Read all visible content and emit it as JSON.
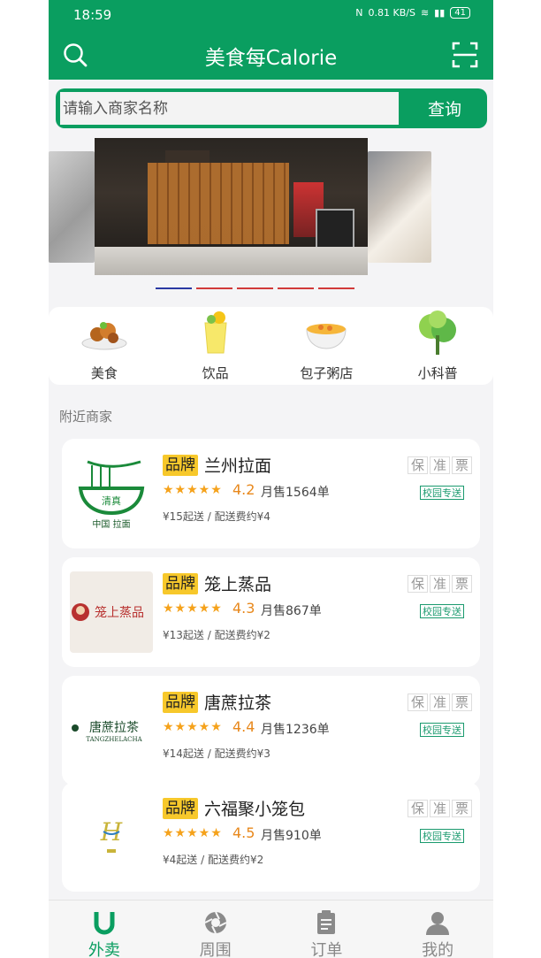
{
  "status": {
    "time": "18:59",
    "net_speed": "0.81 KB/S",
    "battery": "41"
  },
  "header": {
    "title": "美食每Calorie"
  },
  "search": {
    "placeholder": "请输入商家名称",
    "button_label": "查询"
  },
  "categories": [
    {
      "label": "美食",
      "icon": "food-dish-icon"
    },
    {
      "label": "饮品",
      "icon": "drink-cup-icon"
    },
    {
      "label": "包子粥店",
      "icon": "congee-bowl-icon"
    },
    {
      "label": "小科普",
      "icon": "tree-icon"
    }
  ],
  "section": {
    "title": "附近商家"
  },
  "shops": [
    {
      "brand_tag": "品牌",
      "name": "兰州拉面",
      "rating": "4.2",
      "sales": "月售1564单",
      "min_order": "¥15起送",
      "fee": "配送费约¥4",
      "guarantees": [
        "保",
        "准",
        "票"
      ],
      "campus": "校园专送",
      "logo_text": "清真 中国 拉面"
    },
    {
      "brand_tag": "品牌",
      "name": "笼上蒸品",
      "rating": "4.3",
      "sales": "月售867单",
      "min_order": "¥13起送",
      "fee": "配送费约¥2",
      "guarantees": [
        "保",
        "准",
        "票"
      ],
      "campus": "校园专送",
      "logo_text": "笼上蒸品"
    },
    {
      "brand_tag": "品牌",
      "name": "唐蔗拉茶",
      "rating": "4.4",
      "sales": "月售1236单",
      "min_order": "¥14起送",
      "fee": "配送费约¥3",
      "guarantees": [
        "保",
        "准",
        "票"
      ],
      "campus": "校园专送",
      "logo_text": "唐蔗拉茶"
    },
    {
      "brand_tag": "品牌",
      "name": "六福聚小笼包",
      "rating": "4.5",
      "sales": "月售910单",
      "min_order": "¥4起送",
      "fee": "配送费约¥2",
      "guarantees": [
        "保",
        "准",
        "票"
      ],
      "campus": "校园专送",
      "logo_text": "H"
    }
  ],
  "nav": [
    {
      "label": "外卖",
      "icon": "takeout-u-icon",
      "active": true
    },
    {
      "label": "周围",
      "icon": "aperture-icon",
      "active": false
    },
    {
      "label": "订单",
      "icon": "clipboard-icon",
      "active": false
    },
    {
      "label": "我的",
      "icon": "user-icon",
      "active": false
    }
  ],
  "colors": {
    "primary": "#0a9e60",
    "brand_tag": "#f7c82b",
    "rating": "#e8881c",
    "campus": "#1a9a6e"
  }
}
